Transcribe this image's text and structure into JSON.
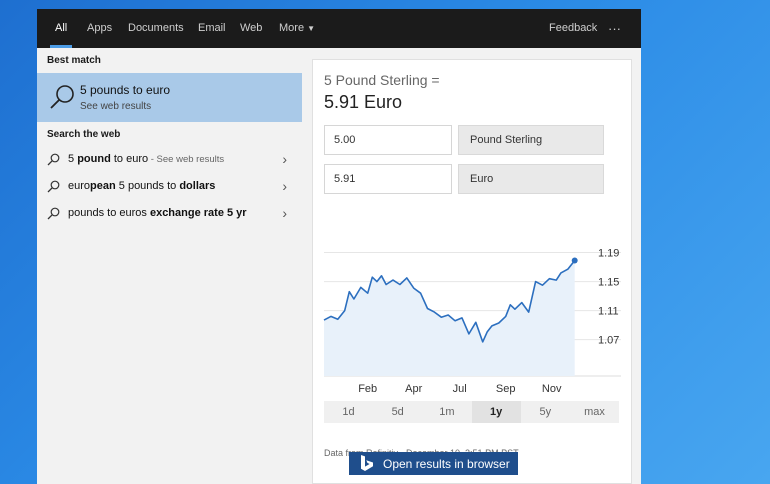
{
  "tabs": [
    "All",
    "Apps",
    "Documents",
    "Email",
    "Web",
    "More"
  ],
  "feedback": "Feedback",
  "ellipsis": "···",
  "left": {
    "best_match_heading": "Best match",
    "best_match": {
      "title": "5 pounds to euro",
      "subtitle": "See web results"
    },
    "search_web_heading": "Search the web",
    "web_results": [
      {
        "parts": [
          {
            "text": "5 ",
            "bold": false
          },
          {
            "text": "pound",
            "bold": true
          },
          {
            "text": " to euro",
            "bold": false
          }
        ],
        "hint": " - See web results"
      },
      {
        "parts": [
          {
            "text": "euro",
            "bold": false
          },
          {
            "text": "pean",
            "bold": true
          },
          {
            "text": " 5 pounds to ",
            "bold": false
          },
          {
            "text": "dollars",
            "bold": true
          }
        ],
        "hint": ""
      },
      {
        "parts": [
          {
            "text": "pounds to euros ",
            "bold": false
          },
          {
            "text": "exchange rate 5 yr",
            "bold": true
          }
        ],
        "hint": ""
      }
    ]
  },
  "converter": {
    "heading": "5 Pound Sterling =",
    "result": "5.91 Euro",
    "from_amount": "5.00",
    "from_currency": "Pound Sterling",
    "to_amount": "5.91",
    "to_currency": "Euro"
  },
  "chart_data": {
    "type": "line",
    "title": "",
    "xlabel": "",
    "ylabel": "",
    "x_ticks": [
      "Feb",
      "Apr",
      "Jul",
      "Sep",
      "Nov"
    ],
    "y_ticks": [
      1.19,
      1.15,
      1.11,
      1.07
    ],
    "ylim": [
      1.02,
      1.21
    ],
    "xlim": [
      0,
      11
    ],
    "grid": true,
    "color": "#2c6fbf",
    "fill_color": "#e8f1fa",
    "series": [
      {
        "x": [
          0,
          0.3,
          0.6,
          0.9,
          1.1,
          1.3,
          1.6,
          1.9,
          2.1,
          2.3,
          2.5,
          2.7,
          3.0,
          3.3,
          3.6,
          3.9,
          4.2,
          4.5,
          4.8,
          5.1,
          5.4,
          5.7,
          6.0,
          6.3,
          6.6,
          6.9,
          7.1,
          7.3,
          7.6,
          7.9,
          8.1,
          8.3,
          8.6,
          8.9,
          9.2,
          9.5,
          9.8,
          10.1,
          10.3,
          10.6,
          10.9
        ],
        "values": [
          1.097,
          1.102,
          1.098,
          1.11,
          1.136,
          1.126,
          1.142,
          1.134,
          1.156,
          1.15,
          1.158,
          1.146,
          1.152,
          1.146,
          1.155,
          1.141,
          1.134,
          1.113,
          1.108,
          1.101,
          1.104,
          1.096,
          1.1,
          1.078,
          1.094,
          1.067,
          1.081,
          1.089,
          1.093,
          1.102,
          1.118,
          1.112,
          1.121,
          1.108,
          1.15,
          1.145,
          1.154,
          1.152,
          1.162,
          1.167,
          1.179
        ]
      }
    ]
  },
  "range_buttons": [
    "1d",
    "5d",
    "1m",
    "1y",
    "5y",
    "max"
  ],
  "active_range": "1y",
  "source": "Data from Refinitiv · December 10, 2:51 PM PST",
  "open_button": "Open results in browser"
}
